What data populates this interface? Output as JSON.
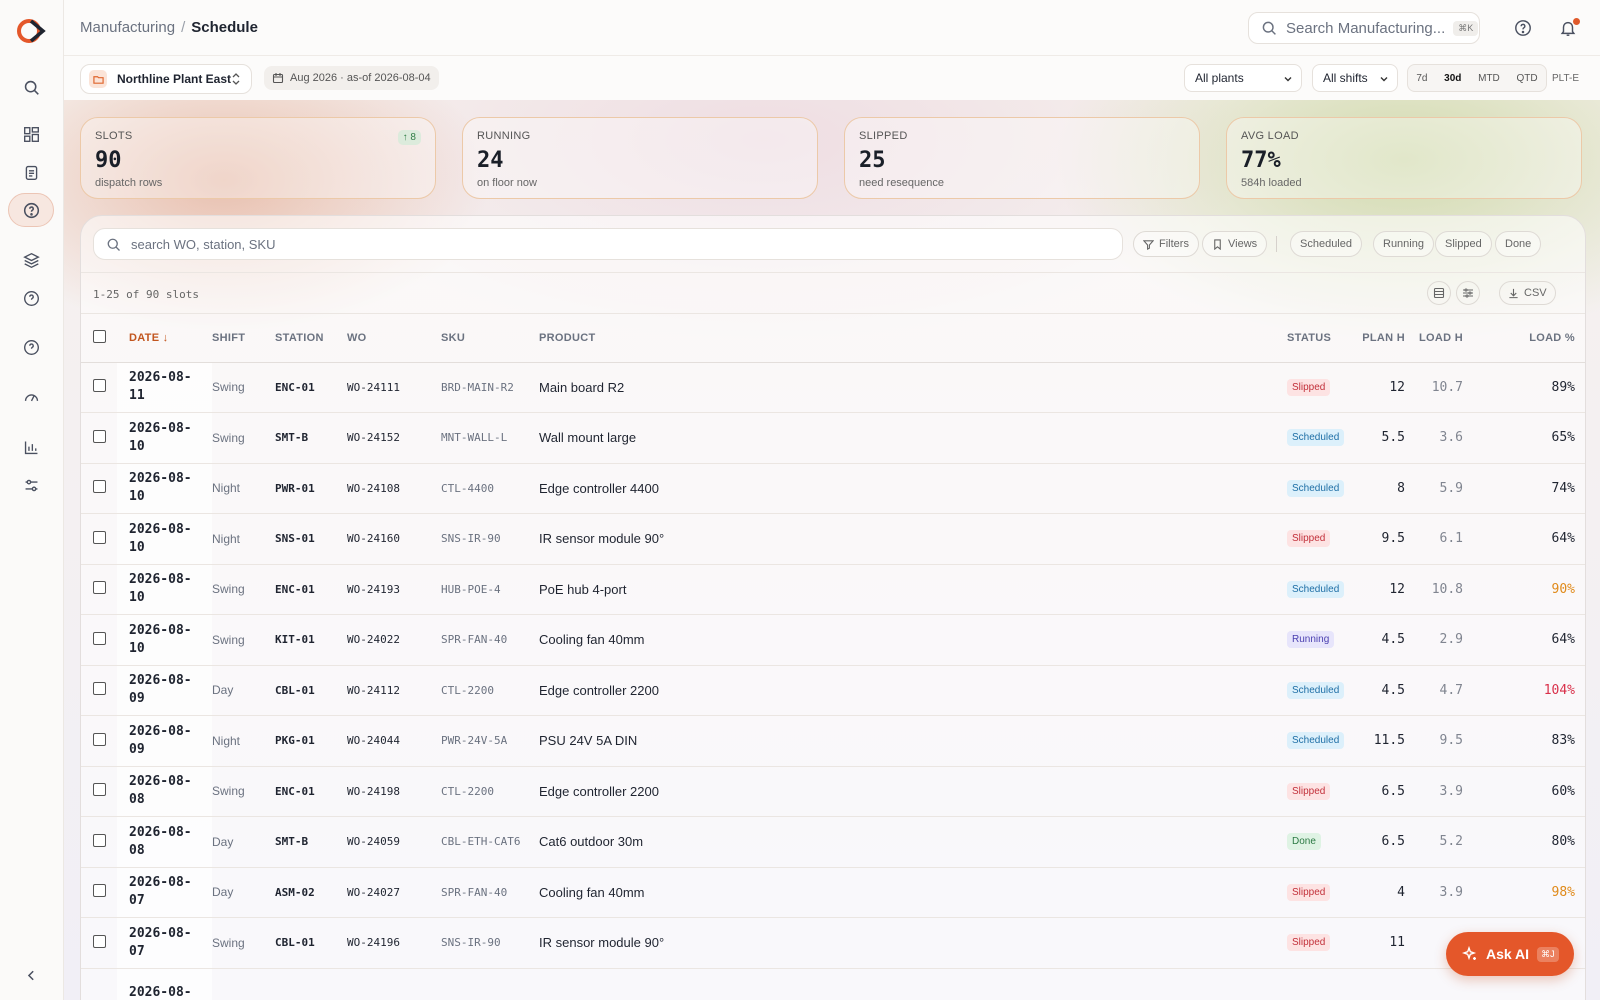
{
  "header": {
    "breadcrumb_root": "Manufacturing",
    "breadcrumb_sep": "/",
    "breadcrumb_current": "Schedule",
    "search_placeholder": "Search Manufacturing...",
    "search_shortcut": "⌘K"
  },
  "toolbar": {
    "plant_name": "Northline Plant East",
    "date_range": "Aug 2026 · as-of 2026-08-04",
    "plants_filter": "All plants",
    "shifts_filter": "All shifts",
    "ranges": [
      "7d",
      "30d",
      "MTD",
      "QTD"
    ],
    "active_range": "30d",
    "plant_code": "PLT-E"
  },
  "kpis": [
    {
      "label": "SLOTS",
      "value": "90",
      "sub": "dispatch rows",
      "delta": "↑ 8"
    },
    {
      "label": "RUNNING",
      "value": "24",
      "sub": "on floor now"
    },
    {
      "label": "SLIPPED",
      "value": "25",
      "sub": "need resequence"
    },
    {
      "label": "AVG LOAD",
      "value": "77%",
      "sub": "584h loaded"
    }
  ],
  "panel": {
    "search_placeholder": "search WO, station, SKU",
    "filters_label": "Filters",
    "views_label": "Views",
    "status_chips": [
      "Scheduled",
      "Running",
      "Slipped",
      "Done"
    ],
    "count_text": "1-25 of 90 slots",
    "csv_label": "CSV"
  },
  "table": {
    "columns": {
      "date": "DATE ↓",
      "shift": "SHIFT",
      "station": "STATION",
      "wo": "WO",
      "sku": "SKU",
      "product": "PRODUCT",
      "status": "STATUS",
      "plan_h": "PLAN H",
      "load_h": "LOAD H",
      "load_pct": "LOAD %"
    },
    "rows": [
      {
        "date": "2026-08-11",
        "shift": "Swing",
        "station": "ENC-01",
        "wo": "WO-24111",
        "sku": "BRD-MAIN-R2",
        "product": "Main board R2",
        "status": "Slipped",
        "plan": "12",
        "load": "10.7",
        "pct": "89%"
      },
      {
        "date": "2026-08-10",
        "shift": "Swing",
        "station": "SMT-B",
        "wo": "WO-24152",
        "sku": "MNT-WALL-L",
        "product": "Wall mount large",
        "status": "Scheduled",
        "plan": "5.5",
        "load": "3.6",
        "pct": "65%"
      },
      {
        "date": "2026-08-10",
        "shift": "Night",
        "station": "PWR-01",
        "wo": "WO-24108",
        "sku": "CTL-4400",
        "product": "Edge controller 4400",
        "status": "Scheduled",
        "plan": "8",
        "load": "5.9",
        "pct": "74%"
      },
      {
        "date": "2026-08-10",
        "shift": "Night",
        "station": "SNS-01",
        "wo": "WO-24160",
        "sku": "SNS-IR-90",
        "product": "IR sensor module 90°",
        "status": "Slipped",
        "plan": "9.5",
        "load": "6.1",
        "pct": "64%"
      },
      {
        "date": "2026-08-10",
        "shift": "Swing",
        "station": "ENC-01",
        "wo": "WO-24193",
        "sku": "HUB-POE-4",
        "product": "PoE hub 4-port",
        "status": "Scheduled",
        "plan": "12",
        "load": "10.8",
        "pct": "90%"
      },
      {
        "date": "2026-08-10",
        "shift": "Swing",
        "station": "KIT-01",
        "wo": "WO-24022",
        "sku": "SPR-FAN-40",
        "product": "Cooling fan 40mm",
        "status": "Running",
        "plan": "4.5",
        "load": "2.9",
        "pct": "64%"
      },
      {
        "date": "2026-08-09",
        "shift": "Day",
        "station": "CBL-01",
        "wo": "WO-24112",
        "sku": "CTL-2200",
        "product": "Edge controller 2200",
        "status": "Scheduled",
        "plan": "4.5",
        "load": "4.7",
        "pct": "104%"
      },
      {
        "date": "2026-08-09",
        "shift": "Night",
        "station": "PKG-01",
        "wo": "WO-24044",
        "sku": "PWR-24V-5A",
        "product": "PSU 24V 5A DIN",
        "status": "Scheduled",
        "plan": "11.5",
        "load": "9.5",
        "pct": "83%"
      },
      {
        "date": "2026-08-08",
        "shift": "Swing",
        "station": "ENC-01",
        "wo": "WO-24198",
        "sku": "CTL-2200",
        "product": "Edge controller 2200",
        "status": "Slipped",
        "plan": "6.5",
        "load": "3.9",
        "pct": "60%"
      },
      {
        "date": "2026-08-08",
        "shift": "Day",
        "station": "SMT-B",
        "wo": "WO-24059",
        "sku": "CBL-ETH-CAT6",
        "product": "Cat6 outdoor 30m",
        "status": "Done",
        "plan": "6.5",
        "load": "5.2",
        "pct": "80%"
      },
      {
        "date": "2026-08-07",
        "shift": "Day",
        "station": "ASM-02",
        "wo": "WO-24027",
        "sku": "SPR-FAN-40",
        "product": "Cooling fan 40mm",
        "status": "Slipped",
        "plan": "4",
        "load": "3.9",
        "pct": "98%"
      },
      {
        "date": "2026-08-07",
        "shift": "Swing",
        "station": "CBL-01",
        "wo": "WO-24196",
        "sku": "SNS-IR-90",
        "product": "IR sensor module 90°",
        "status": "Slipped",
        "plan": "11",
        "load": "",
        "pct": ""
      },
      {
        "date": "2026-08-",
        "shift": "",
        "station": "",
        "wo": "",
        "sku": "",
        "product": "",
        "status": "",
        "plan": "",
        "load": "",
        "pct": ""
      }
    ]
  },
  "ask_ai": {
    "label": "Ask AI",
    "shortcut": "⌘J"
  },
  "colors": {
    "accent": "#e4572a",
    "warn": "#e08a1a",
    "over": "#d9304a"
  }
}
